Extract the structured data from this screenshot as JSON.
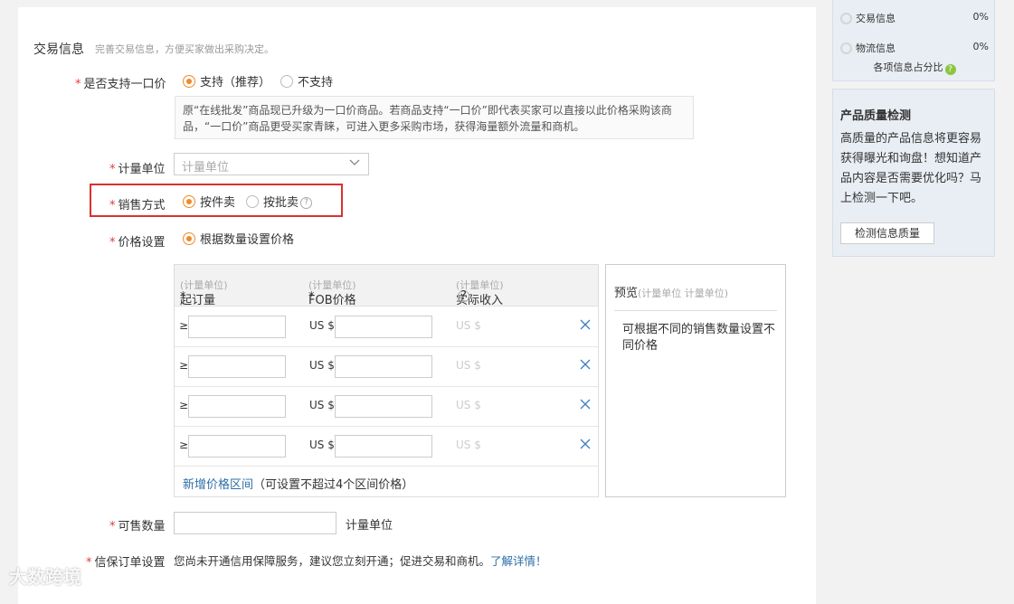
{
  "section": {
    "title": "交易信息",
    "subtitle": "完善交易信息，方便买家做出采购决定。"
  },
  "one_price": {
    "label": "是否支持一口价",
    "option_yes": "支持（推荐）",
    "option_no": "不支持",
    "info": "原“在线批发”商品现已升级为一口价商品。若商品支持“一口价”即代表买家可以直接以此价格采购该商品，“一口价”商品更受买家青睐，可进入更多采购市场，获得海量额外流量和商机。"
  },
  "unit": {
    "label": "计量单位",
    "placeholder": "计量单位"
  },
  "sale_method": {
    "label": "销售方式",
    "option_piece": "按件卖",
    "option_batch": "按批卖",
    "help": "?"
  },
  "price_setting": {
    "label": "价格设置",
    "option": "根据数量设置价格"
  },
  "price_table": {
    "col_moq": "起订量",
    "col_moq_unit": "(计量单位)",
    "col_fob": "FOB价格",
    "col_fob_unit": "(计量单位)",
    "col_actual": "实际收入",
    "col_actual_unit": "(计量单位)",
    "rows": [
      {
        "ge": "≥",
        "currency": "US $",
        "actual": "US $"
      },
      {
        "ge": "≥",
        "currency": "US $",
        "actual": "US $"
      },
      {
        "ge": "≥",
        "currency": "US $",
        "actual": "US $"
      },
      {
        "ge": "≥",
        "currency": "US $",
        "actual": "US $"
      }
    ],
    "add_link": "新增价格区间",
    "add_note": "（可设置不超过4个区间价格）"
  },
  "preview": {
    "title": "预览",
    "unit_hint": "(计量单位 计量单位)",
    "text": "可根据不同的销售数量设置不同价格"
  },
  "available_qty": {
    "label": "可售数量",
    "unit": "计量单位"
  },
  "trade_assurance": {
    "label": "信保订单设置",
    "text": "您尚未开通信用保障服务，建议您立刻开通；促进交易和商机。",
    "link": "了解详情！"
  },
  "sidebar": {
    "progress": [
      {
        "label": "交易信息",
        "pct": "0%"
      },
      {
        "label": "物流信息",
        "pct": "0%"
      }
    ],
    "ratio_label": "各项信息占分比",
    "quality": {
      "title": "产品质量检测",
      "desc": "高质量的产品信息将更容易获得曝光和询盘！想知道产品内容是否需要优化吗？马上检测一下吧。",
      "button": "检测信息质量"
    }
  },
  "watermark": "大数跨境",
  "colors": {
    "accent": "#f08a28",
    "required": "#e4393c",
    "link": "#2d6ea7",
    "highlight_border": "#d9312f"
  }
}
